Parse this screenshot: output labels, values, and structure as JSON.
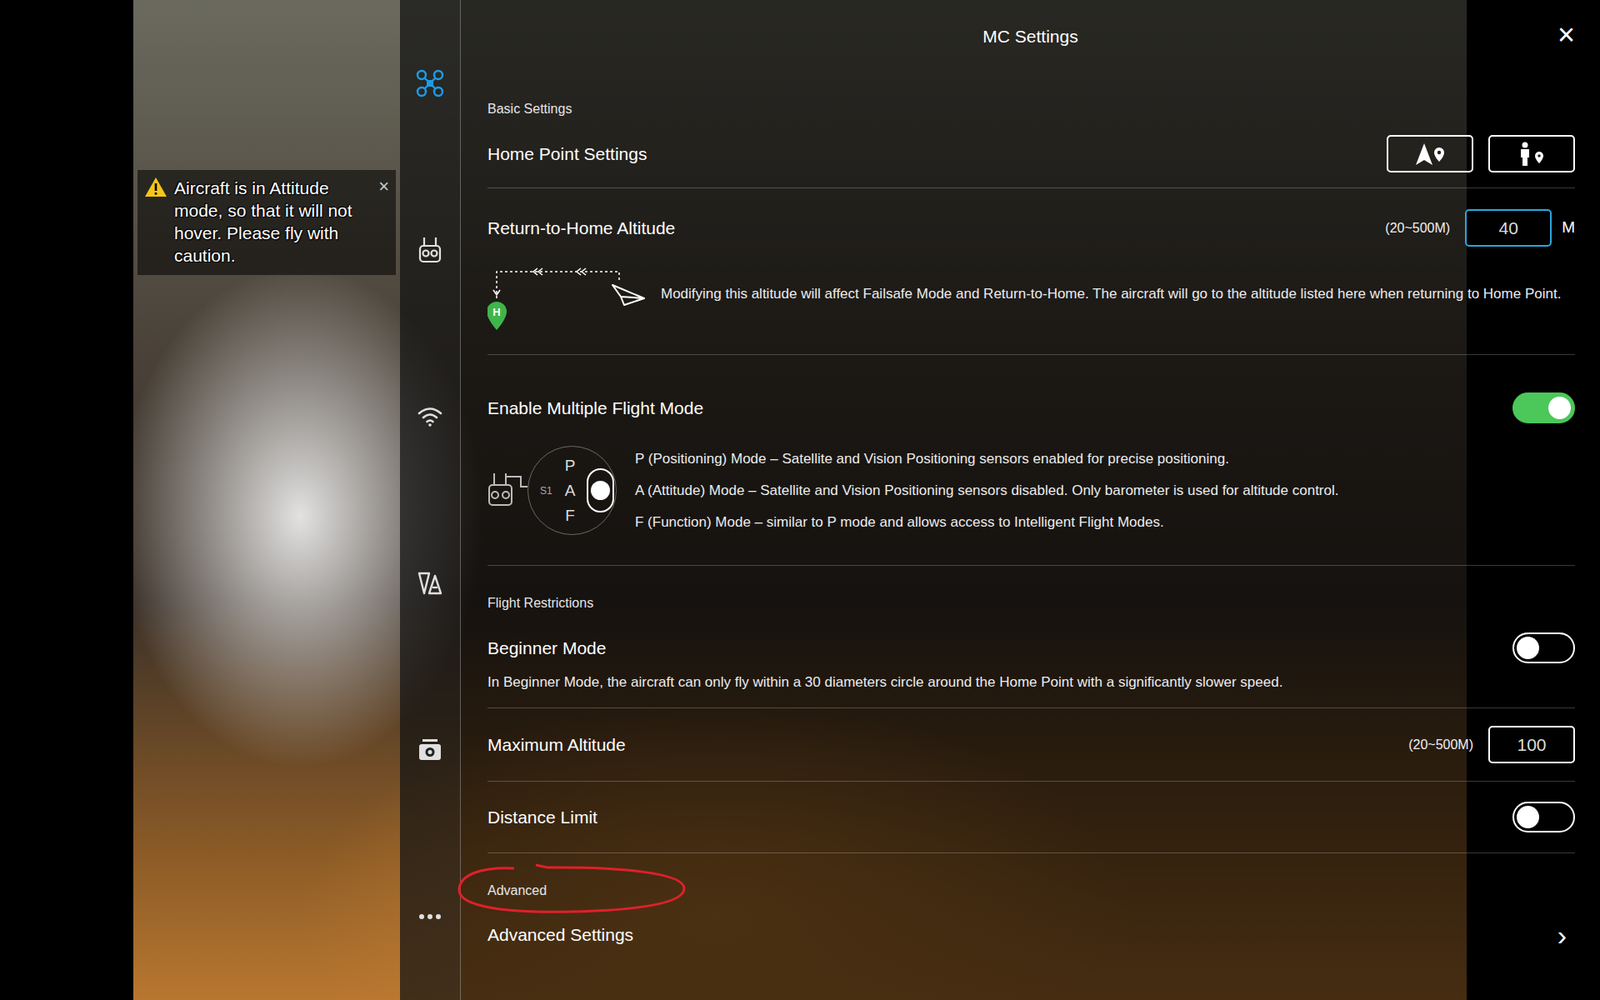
{
  "panel": {
    "title": "MC Settings",
    "close": "×"
  },
  "toast": {
    "text": "Aircraft is in Attitude mode, so that it will not hover. Please fly with caution.",
    "close": "×"
  },
  "sidebar": {
    "items": [
      {
        "kind": "aircraft",
        "selected": true
      },
      {
        "kind": "remote",
        "selected": false
      },
      {
        "kind": "signal",
        "selected": false
      },
      {
        "kind": "display",
        "selected": false
      },
      {
        "kind": "camera",
        "selected": false
      },
      {
        "kind": "more",
        "selected": false
      }
    ]
  },
  "sections": [
    {
      "title": "Basic Settings",
      "annotated": false,
      "rows": [
        {
          "kind": "buttons",
          "label": "Home Point Settings",
          "buttons": [
            {
              "kind": "aircraft-location"
            },
            {
              "kind": "operator-location"
            }
          ]
        },
        {
          "kind": "number",
          "label": "Return-to-Home Altitude",
          "range": "(20~500M)",
          "value": "40",
          "unit": "M",
          "focused": true,
          "note": "Modifying this altitude will affect Failsafe Mode and Return-to-Home. The aircraft will go to the altitude listed here when returning to Home Point.",
          "diagram": {
            "pin": "H"
          }
        },
        {
          "kind": "toggle",
          "label": "Enable Multiple Flight Mode",
          "on": true,
          "switch": {
            "label": "S1",
            "positions": [
              {
                "label": "P",
                "selected": false
              },
              {
                "label": "A",
                "selected": true
              },
              {
                "label": "F",
                "selected": false
              }
            ]
          },
          "modes": [
            "P (Positioning) Mode – Satellite and Vision Positioning sensors enabled for precise positioning.",
            "A (Attitude) Mode – Satellite and Vision Positioning sensors disabled. Only barometer is used for altitude control.",
            "F (Function) Mode – similar to P mode and allows access to Intelligent Flight Modes."
          ]
        }
      ]
    },
    {
      "title": "Flight Restrictions",
      "annotated": false,
      "rows": [
        {
          "kind": "toggle",
          "label": "Beginner Mode",
          "on": false,
          "note": "In Beginner Mode, the aircraft can only fly within a 30 diameters circle around the Home Point with a significantly slower speed."
        },
        {
          "kind": "number",
          "label": "Maximum Altitude",
          "range": "(20~500M)",
          "value": "100",
          "unit": "",
          "focused": false
        },
        {
          "kind": "toggle",
          "label": "Distance Limit",
          "on": false
        }
      ]
    },
    {
      "title": "Advanced",
      "annotated": true,
      "rows": [
        {
          "kind": "link",
          "label": "Advanced Settings",
          "chevron": "›"
        }
      ]
    }
  ]
}
